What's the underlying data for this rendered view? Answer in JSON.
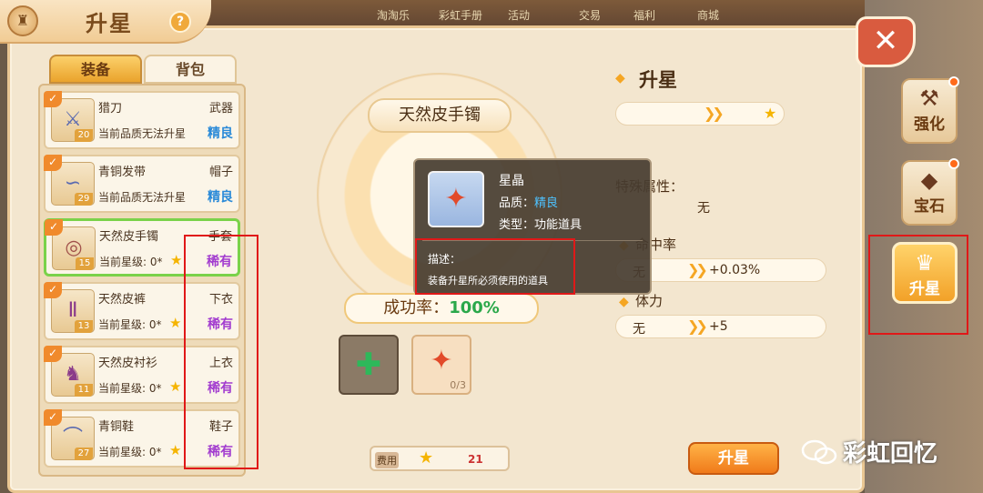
{
  "title": "升星",
  "help_icon": "?",
  "close_icon": "✕",
  "top_nav": [
    "淘淘乐",
    "彩虹手册",
    "活动",
    "交易",
    "福利",
    "商城"
  ],
  "tabs": [
    "装备",
    "背包"
  ],
  "items": [
    {
      "name": "猎刀",
      "type": "武器",
      "level": "20",
      "desc": "当前品质无法升星",
      "quality": "精良",
      "quality_class": "good",
      "icon": "sword-icon",
      "selected": false,
      "has_star": false
    },
    {
      "name": "青铜发带",
      "type": "帽子",
      "level": "29",
      "desc": "当前品质无法升星",
      "quality": "精良",
      "quality_class": "good",
      "icon": "headband-icon",
      "selected": false,
      "has_star": false
    },
    {
      "name": "天然皮手镯",
      "type": "手套",
      "level": "15",
      "desc": "当前星级: 0*",
      "quality": "稀有",
      "quality_class": "rare",
      "icon": "bracelet-icon",
      "selected": true,
      "has_star": true
    },
    {
      "name": "天然皮裤",
      "type": "下衣",
      "level": "13",
      "desc": "当前星级: 0*",
      "quality": "稀有",
      "quality_class": "rare",
      "icon": "pants-icon",
      "selected": false,
      "has_star": true
    },
    {
      "name": "天然皮衬衫",
      "type": "上衣",
      "level": "11",
      "desc": "当前星级: 0*",
      "quality": "稀有",
      "quality_class": "rare",
      "icon": "shirt-icon",
      "selected": false,
      "has_star": true
    },
    {
      "name": "青铜鞋",
      "type": "鞋子",
      "level": "27",
      "desc": "当前星级: 0*",
      "quality": "稀有",
      "quality_class": "rare",
      "icon": "shoes-icon",
      "selected": false,
      "has_star": true
    }
  ],
  "center": {
    "item_title": "天然皮手镯",
    "rate_label": "成功率：",
    "rate_value": "100%",
    "slot_count": "0/3",
    "cost_label": "费用",
    "cost_value": "21",
    "upgrade_button": "升星"
  },
  "right": {
    "title": "升星",
    "special_label": "特殊属性：",
    "special_value": "无",
    "hit_label": "命中率",
    "hit_from": "无",
    "hit_to": "+0.03%",
    "stamina_label": "体力",
    "stamina_from": "无",
    "stamina_to": "+5"
  },
  "side_tabs": [
    {
      "label": "强化",
      "icon": "anvil-icon",
      "dot": true
    },
    {
      "label": "宝石",
      "icon": "gem-icon",
      "dot": true
    },
    {
      "label": "升星",
      "icon": "star-up-icon",
      "dot": false
    }
  ],
  "tooltip": {
    "name": "星晶",
    "quality_label": "品质：",
    "quality_value": "精良",
    "type_text": "类型：功能道具",
    "desc_label": "描述：",
    "desc_text": "装备升星所必须使用的道具"
  },
  "watermark": "彩虹回忆",
  "colors": {
    "good": "#2a8ad8",
    "rare": "#a23ccf",
    "success": "#2aa84a",
    "accent": "#f07a1a",
    "highlight_box": "#e01818"
  }
}
